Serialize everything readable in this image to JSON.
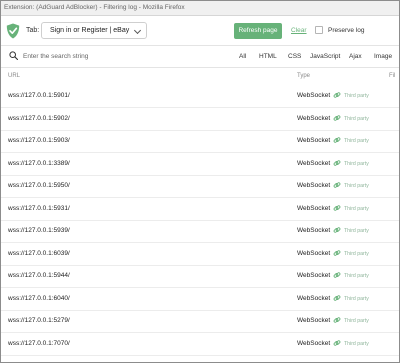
{
  "window": {
    "title": "Extension: (AdGuard AdBlocker) - Filtering log - Mozilla Firefox"
  },
  "toolbar": {
    "tab_label": "Tab:",
    "tab_selected": "Sign in or Register | eBay",
    "refresh_label": "Refresh page",
    "clear_label": "Clear",
    "preserve_label": "Preserve log",
    "preserve_checked": false,
    "accent_color": "#67b279"
  },
  "search": {
    "placeholder": "Enter the search string",
    "value": ""
  },
  "filters": {
    "all": "All",
    "html": "HTML",
    "css": "CSS",
    "javascript": "JavaScript",
    "ajax": "Ajax",
    "image": "Image"
  },
  "table": {
    "headers": {
      "url": "URL",
      "type": "Type",
      "filter": "Fil"
    },
    "rows": [
      {
        "url": "wss://127.0.0.1:5901/",
        "type": "WebSocket",
        "party": "Third party"
      },
      {
        "url": "wss://127.0.0.1:5902/",
        "type": "WebSocket",
        "party": "Third party"
      },
      {
        "url": "wss://127.0.0.1:5903/",
        "type": "WebSocket",
        "party": "Third party"
      },
      {
        "url": "wss://127.0.0.1:3389/",
        "type": "WebSocket",
        "party": "Third party"
      },
      {
        "url": "wss://127.0.0.1:5950/",
        "type": "WebSocket",
        "party": "Third party"
      },
      {
        "url": "wss://127.0.0.1:5931/",
        "type": "WebSocket",
        "party": "Third party"
      },
      {
        "url": "wss://127.0.0.1:5939/",
        "type": "WebSocket",
        "party": "Third party"
      },
      {
        "url": "wss://127.0.0.1:6039/",
        "type": "WebSocket",
        "party": "Third party"
      },
      {
        "url": "wss://127.0.0.1:5944/",
        "type": "WebSocket",
        "party": "Third party"
      },
      {
        "url": "wss://127.0.0.1:6040/",
        "type": "WebSocket",
        "party": "Third party"
      },
      {
        "url": "wss://127.0.0.1:5279/",
        "type": "WebSocket",
        "party": "Third party"
      },
      {
        "url": "wss://127.0.0.1:7070/",
        "type": "WebSocket",
        "party": "Third party"
      }
    ]
  },
  "icons": {
    "logo": "adguard-shield-icon",
    "search": "search-icon",
    "chevron": "chevron-down-icon",
    "link": "link-icon"
  }
}
